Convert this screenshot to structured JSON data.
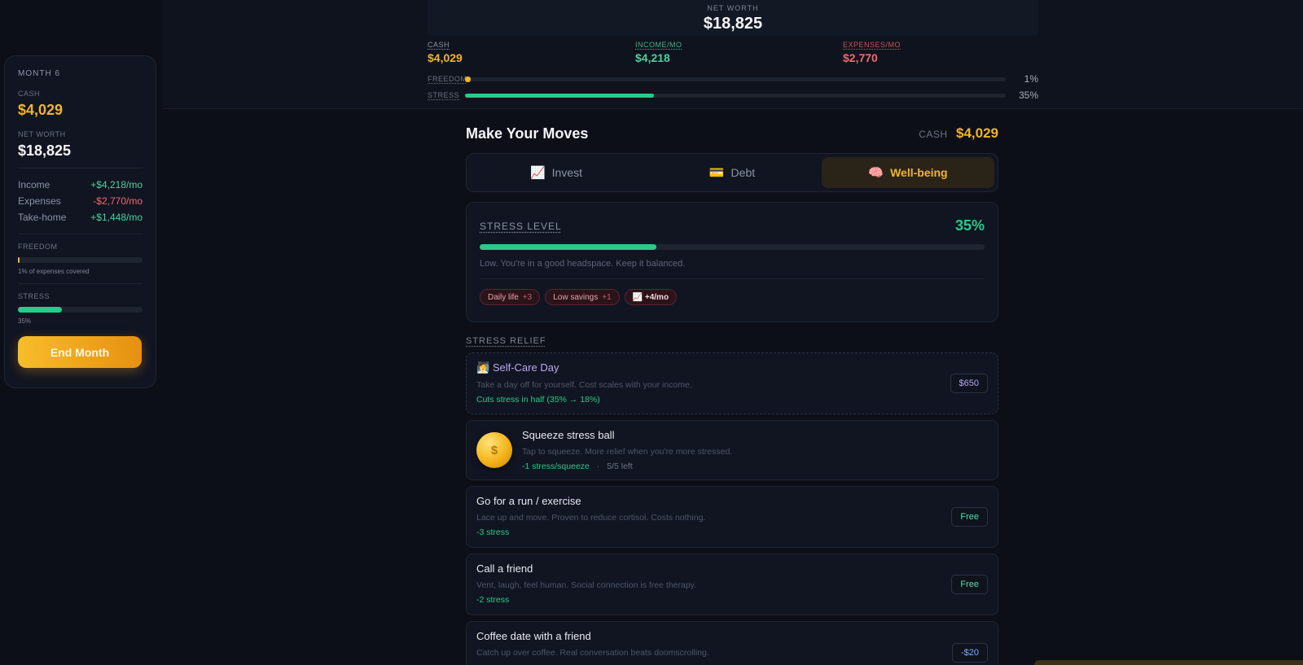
{
  "topbar": {
    "net_worth_label": "NET WORTH",
    "net_worth_value": "$18,825",
    "cash_label": "CASH",
    "cash_value": "$4,029",
    "income_label": "INCOME/MO",
    "income_value": "$4,218",
    "expenses_label": "EXPENSES/MO",
    "expenses_value": "$2,770",
    "freedom_label": "FREEDOM",
    "freedom_pct": "1%",
    "freedom_fraction": 0.01,
    "stress_label": "STRESS",
    "stress_pct": "35%",
    "stress_fraction": 0.35
  },
  "sidebar": {
    "month": "MONTH 6",
    "cash_label": "CASH",
    "cash_value": "$4,029",
    "net_worth_label": "NET WORTH",
    "net_worth_value": "$18,825",
    "income_label": "Income",
    "income_value": "+$4,218/mo",
    "expenses_label": "Expenses",
    "expenses_value": "-$2,770/mo",
    "takehome_label": "Take-home",
    "takehome_value": "+$1,448/mo",
    "freedom_label": "FREEDOM",
    "freedom_note": "1% of expenses covered",
    "stress_label": "STRESS",
    "stress_note": "35%",
    "end_month_label": "End Month"
  },
  "main": {
    "title": "Make Your Moves",
    "cash_label": "CASH",
    "cash_value": "$4,029",
    "tabs": [
      {
        "icon": "📈",
        "label": "Invest"
      },
      {
        "icon": "💳",
        "label": "Debt"
      },
      {
        "icon": "🧠",
        "label": "Well-being"
      }
    ],
    "stress_card": {
      "label": "STRESS LEVEL",
      "pct": "35%",
      "fraction": 0.35,
      "description": "Low. You're in a good headspace. Keep it balanced.",
      "chips": [
        {
          "label": "Daily life",
          "value": "+3"
        },
        {
          "label": "Low savings",
          "value": "+1"
        },
        {
          "label": "📈 +4/mo",
          "value": ""
        }
      ]
    },
    "relief_label": "STRESS RELIEF",
    "items": [
      {
        "icon": "🧖",
        "title": "Self-Care Day",
        "description": "Take a day off for yourself. Cost scales with your income.",
        "effect": "Cuts stress in half (35% → 18%)",
        "price": "$650"
      },
      {
        "coin_symbol": "$",
        "title": "Squeeze stress ball",
        "description": "Tap to squeeze. More relief when you're more stressed.",
        "effect": "-1 stress/squeeze",
        "separator": "·",
        "left": "5/5 left"
      },
      {
        "title": "Go for a run / exercise",
        "description": "Lace up and move. Proven to reduce cortisol. Costs nothing.",
        "effect": "-3 stress",
        "price": "Free"
      },
      {
        "title": "Call a friend",
        "description": "Vent, laugh, feel human. Social connection is free therapy.",
        "effect": "-2 stress",
        "price": "Free"
      },
      {
        "title": "Coffee date with a friend",
        "description": "Catch up over coffee. Real conversation beats doomscrolling.",
        "price": "-$20"
      }
    ]
  },
  "colors": {
    "accent_gold": "#f2b42a",
    "positive_green": "#2bc98a",
    "negative_red": "#ef6b6b",
    "income_teal": "#4ecf9f",
    "self_care_purple": "#b9a7f2"
  }
}
